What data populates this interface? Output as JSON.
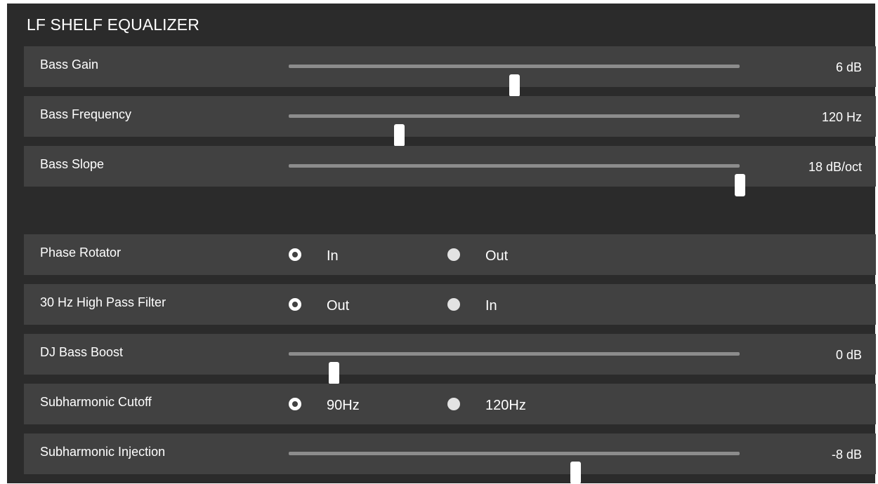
{
  "title": "LF SHELF EQUALIZER",
  "sliders": {
    "bass_gain": {
      "label": "Bass Gain",
      "value": "6 dB",
      "position": 0.5
    },
    "bass_frequency": {
      "label": "Bass Frequency",
      "value": "120 Hz",
      "position": 0.245
    },
    "bass_slope": {
      "label": "Bass Slope",
      "value": "18 dB/oct",
      "position": 1.0
    },
    "dj_bass_boost": {
      "label": "DJ Bass Boost",
      "value": "0 dB",
      "position": 0.1
    },
    "subharmonic_injection": {
      "label": "Subharmonic Injection",
      "value": "-8 dB",
      "position": 0.635
    }
  },
  "radios": {
    "phase_rotator": {
      "label": "Phase Rotator",
      "options": [
        "In",
        "Out"
      ],
      "selected": "In"
    },
    "hpf_30hz": {
      "label": "30 Hz High Pass Filter",
      "options": [
        "Out",
        "In"
      ],
      "selected": "Out"
    },
    "subharmonic_cutoff": {
      "label": "Subharmonic Cutoff",
      "options": [
        "90Hz",
        "120Hz"
      ],
      "selected": "90Hz"
    }
  },
  "icons": {
    "radio_selected": "radio-selected-icon",
    "radio_unselected": "radio-unselected-icon"
  },
  "colors": {
    "panel_background": "#2b2b2b",
    "row_background": "#414141",
    "track": "#8c8c8c",
    "thumb": "#ffffff",
    "text": "#ffffff"
  }
}
